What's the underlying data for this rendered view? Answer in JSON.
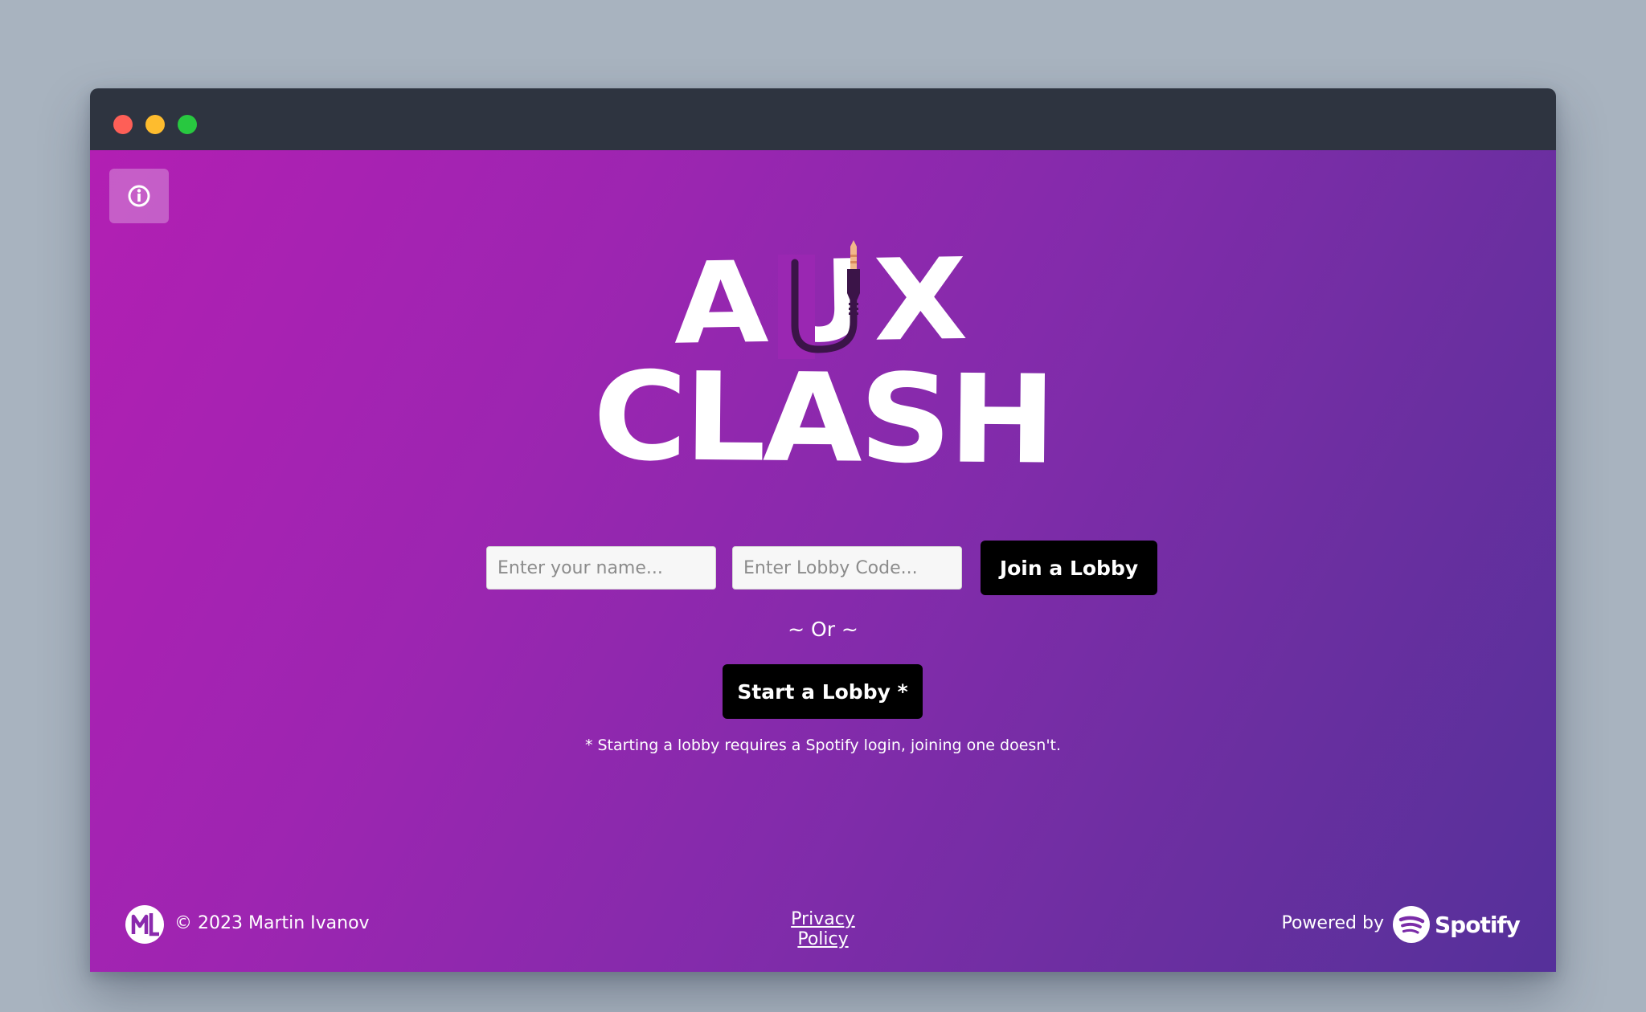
{
  "logo": {
    "line1": "AUX",
    "line2": "CLASH"
  },
  "form": {
    "name_placeholder": "Enter your name...",
    "code_placeholder": "Enter Lobby Code...",
    "join_label": "Join a Lobby",
    "or_text": "~ Or ~",
    "start_label": "Start a Lobby *",
    "note": "* Starting a lobby requires a Spotify login, joining one doesn't."
  },
  "footer": {
    "copyright": "© 2023 Martin Ivanov",
    "privacy": "Privacy Policy",
    "powered_by": "Powered by",
    "spotify": "Spotify"
  },
  "icons": {
    "info": "info-icon",
    "author_logo": "author-logo-icon",
    "spotify_logo": "spotify-icon",
    "aux_cable": "aux-cable-icon"
  },
  "colors": {
    "gradient_start": "#b21fb3",
    "gradient_end": "#55309a",
    "button_bg": "#000000",
    "titlebar": "#2e3440"
  }
}
